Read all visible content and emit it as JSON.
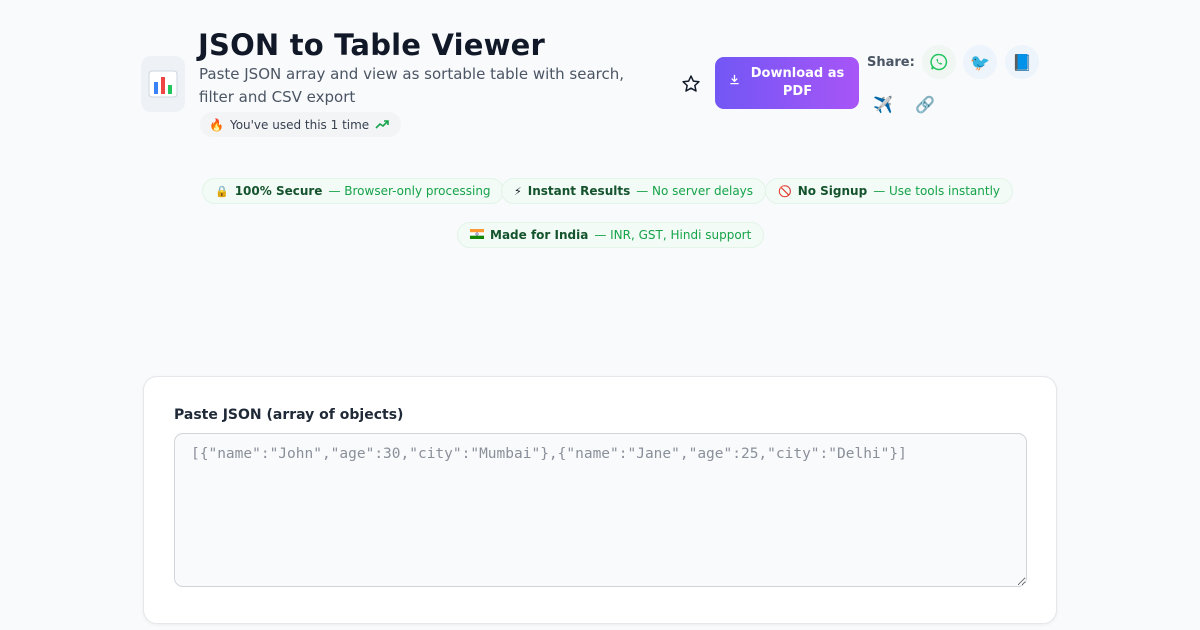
{
  "header": {
    "title": "JSON to Table Viewer",
    "subtitle": "Paste JSON array and view as sortable table with search, filter and CSV export",
    "app_icon": "bar-chart-icon",
    "usage_text": "You've used this 1 time",
    "download_label": "Download as PDF",
    "share_label": "Share:"
  },
  "share_icons": [
    "whatsapp-icon",
    "twitter-icon",
    "facebook-icon",
    "telegram-icon",
    "link-icon"
  ],
  "badges": [
    {
      "strong": "100% Secure",
      "rest": "— Browser-only processing",
      "icon": "lock-icon"
    },
    {
      "strong": "Instant Results",
      "rest": "— No server delays",
      "icon": "lightning-icon"
    },
    {
      "strong": "No Signup",
      "rest": "— Use tools instantly",
      "icon": "no-entry-icon"
    },
    {
      "strong": "Made for India",
      "rest": "— INR, GST, Hindi support",
      "icon": "india-flag-icon"
    }
  ],
  "editor": {
    "label": "Paste JSON (array of objects)",
    "value": "",
    "placeholder": "[{\"name\":\"John\",\"age\":30,\"city\":\"Mumbai\"},{\"name\":\"Jane\",\"age\":25,\"city\":\"Delhi\"}]"
  },
  "colors": {
    "accent_start": "#7257f5",
    "accent_end": "#a855f7",
    "badge_text": "#16a34a",
    "badge_strong": "#14532d",
    "page_bg": "#f8fafc"
  }
}
